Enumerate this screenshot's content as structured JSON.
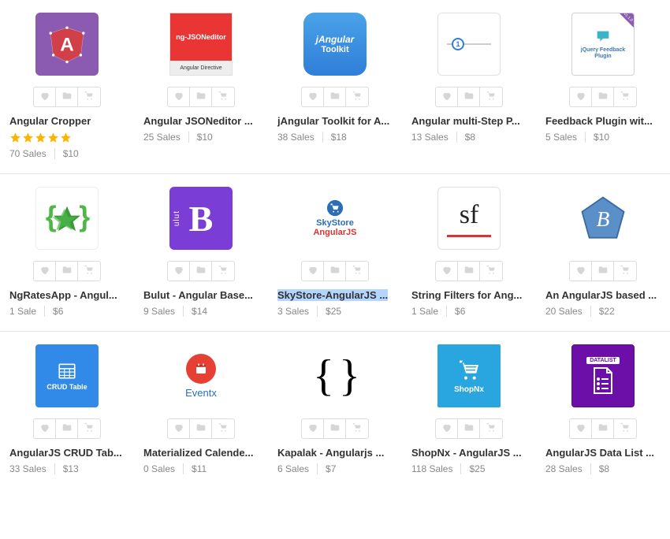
{
  "products": [
    {
      "title": "Angular Cropper",
      "sales": "70 Sales",
      "price": "$10",
      "rating": 5,
      "thumb": "angular-cropper"
    },
    {
      "title": "Angular JSONeditor ...",
      "sales": "25 Sales",
      "price": "$10",
      "thumb": "ng-jsoneditor",
      "thumbText1": "ng-JSONeditor",
      "thumbText2": "Angular Directive"
    },
    {
      "title": "jAngular Toolkit for A...",
      "sales": "38 Sales",
      "price": "$18",
      "thumb": "jangular",
      "thumbText1": "jAngular",
      "thumbText2": "Toolkit"
    },
    {
      "title": "Angular multi-Step P...",
      "sales": "13 Sales",
      "price": "$8",
      "thumb": "multistep",
      "thumbText1": "1"
    },
    {
      "title": "Feedback Plugin wit...",
      "sales": "5 Sales",
      "price": "$10",
      "thumb": "feedback",
      "thumbText1": "jQuery Feedback Plugin"
    },
    {
      "title": "NgRatesApp - Angul...",
      "sales": "1 Sale",
      "price": "$6",
      "thumb": "ngrates"
    },
    {
      "title": "Bulut - Angular Base...",
      "sales": "9 Sales",
      "price": "$14",
      "thumb": "bulut",
      "thumbText1": "B",
      "thumbText2": "ulut"
    },
    {
      "title": "SkyStore-AngularJS ...",
      "sales": "3 Sales",
      "price": "$25",
      "thumb": "skystore",
      "thumbText1": "SkyStore",
      "thumbText2": "AngularJS",
      "selected": true
    },
    {
      "title": "String Filters for Ang...",
      "sales": "1 Sale",
      "price": "$6",
      "thumb": "sf",
      "thumbText1": "sf"
    },
    {
      "title": "An AngularJS based ...",
      "sales": "20 Sales",
      "price": "$22",
      "thumb": "pentagon",
      "thumbText1": "B"
    },
    {
      "title": "AngularJS CRUD Tab...",
      "sales": "33 Sales",
      "price": "$13",
      "thumb": "crud",
      "thumbText1": "CRUD Table"
    },
    {
      "title": "Materialized Calende...",
      "sales": "0 Sales",
      "price": "$11",
      "thumb": "eventx",
      "thumbText1": "Eventx"
    },
    {
      "title": "Kapalak - Angularjs ...",
      "sales": "6 Sales",
      "price": "$7",
      "thumb": "kapalak",
      "thumbText1": "{ }"
    },
    {
      "title": "ShopNx - AngularJS ...",
      "sales": "118 Sales",
      "price": "$25",
      "thumb": "shopnx",
      "thumbText1": "ShopNx"
    },
    {
      "title": "AngularJS Data List ...",
      "sales": "28 Sales",
      "price": "$8",
      "thumb": "datalist",
      "thumbText1": "DATALIST"
    }
  ]
}
